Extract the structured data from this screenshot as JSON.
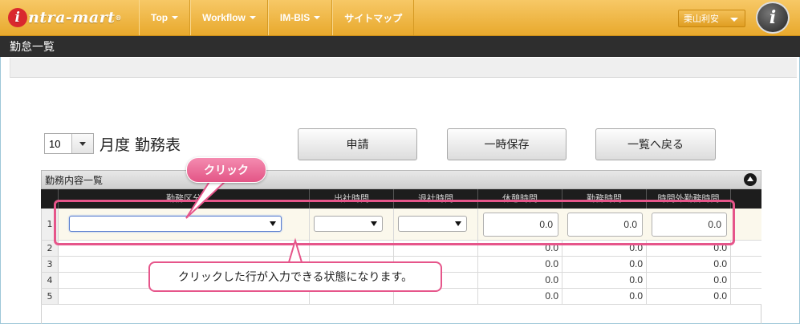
{
  "header": {
    "logo_text": "ntra-mart",
    "logo_i": "i",
    "logo_reg": "®",
    "nav": [
      "Top",
      "Workflow",
      "IM-BIS",
      "サイトマップ"
    ],
    "user_name": "栗山利安",
    "info_symbol": "i"
  },
  "page": {
    "title": "勤怠一覧"
  },
  "controls": {
    "month_value": "10",
    "month_label": "月度 勤務表",
    "apply_label": "申請",
    "save_label": "一時保存",
    "back_label": "一覧へ戻る"
  },
  "panel": {
    "title": "勤務内容一覧",
    "columns": [
      "勤務区分",
      "出社時間",
      "退社時間",
      "休憩時間",
      "勤務時間",
      "時間外勤務時間"
    ],
    "rows": [
      {
        "no": "1",
        "rest": "0.0",
        "work": "0.0",
        "overtime": "0.0"
      },
      {
        "no": "2",
        "rest": "0.0",
        "work": "0.0",
        "overtime": "0.0"
      },
      {
        "no": "3",
        "rest": "0.0",
        "work": "0.0",
        "overtime": "0.0"
      },
      {
        "no": "4",
        "rest": "0.0",
        "work": "0.0",
        "overtime": "0.0"
      },
      {
        "no": "5",
        "rest": "0.0",
        "work": "0.0",
        "overtime": "0.0"
      }
    ]
  },
  "annotations": {
    "click_label": "クリック",
    "callout_text": "クリックした行が入力できる状態になります。",
    "accent_color": "#e6558a"
  }
}
